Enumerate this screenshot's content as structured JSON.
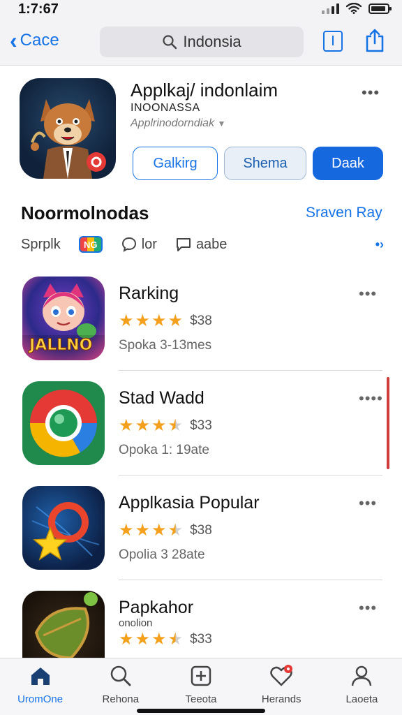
{
  "status": {
    "time": "1:7:67"
  },
  "nav": {
    "back_label": "Cace",
    "search_text": "Indonsia",
    "icons": {
      "back": "chevron-left-icon",
      "search": "search-icon",
      "bookmark": "bookmark-icon",
      "share": "share-icon"
    }
  },
  "app": {
    "title": "Applkaj/ indonlaim",
    "subtitle": "INOONASSA",
    "developer": "Applrinodorndiak",
    "more": "•••",
    "buttons": {
      "get": "Galkirg",
      "share": "Shema",
      "open": "Daak"
    }
  },
  "section": {
    "title": "Noormolnodas",
    "link": "Sraven Ray",
    "filters": [
      {
        "label": "Sprplk",
        "icon": ""
      },
      {
        "label": "",
        "badge": "NG"
      },
      {
        "label": "lor",
        "icon": "chat-bubble-icon"
      },
      {
        "label": "aabe",
        "icon": "message-square-icon"
      }
    ],
    "filters_more": "•›"
  },
  "items": [
    {
      "title": "Rarking",
      "sub": "",
      "rating": 4,
      "price": "$38",
      "meta": "Spoka 3-13mes",
      "more": "•••",
      "icon": "cat-game-icon",
      "icon_text": "JALLNO"
    },
    {
      "title": "Stad Wadd",
      "sub": "",
      "rating": 3.5,
      "price": "$33",
      "meta": "Opoka 1: 19ate",
      "more": "••••",
      "icon": "browser-icon",
      "icon_text": ""
    },
    {
      "title": "Applkasia Popular",
      "sub": "",
      "rating": 3.5,
      "price": "$38",
      "meta": "Opolia 3 28ate",
      "more": "•••",
      "icon": "star-ring-icon",
      "icon_text": ""
    },
    {
      "title": "Papkahor",
      "sub": "onolion",
      "rating": 3.5,
      "price": "$33",
      "meta": "",
      "more": "•••",
      "icon": "leaf-shield-icon",
      "icon_text": ""
    }
  ],
  "tabs": [
    {
      "label": "UromOne",
      "icon": "home-icon",
      "active": true
    },
    {
      "label": "Rehona",
      "icon": "search-icon",
      "active": false
    },
    {
      "label": "Teeota",
      "icon": "plus-square-icon",
      "active": false
    },
    {
      "label": "Herands",
      "icon": "heart-icon",
      "active": false
    },
    {
      "label": "Laoeta",
      "icon": "person-icon",
      "active": false
    }
  ],
  "colors": {
    "accent": "#1673e6",
    "star": "#f4a01c",
    "open_button": "#1668de",
    "badge": "#e53935"
  }
}
